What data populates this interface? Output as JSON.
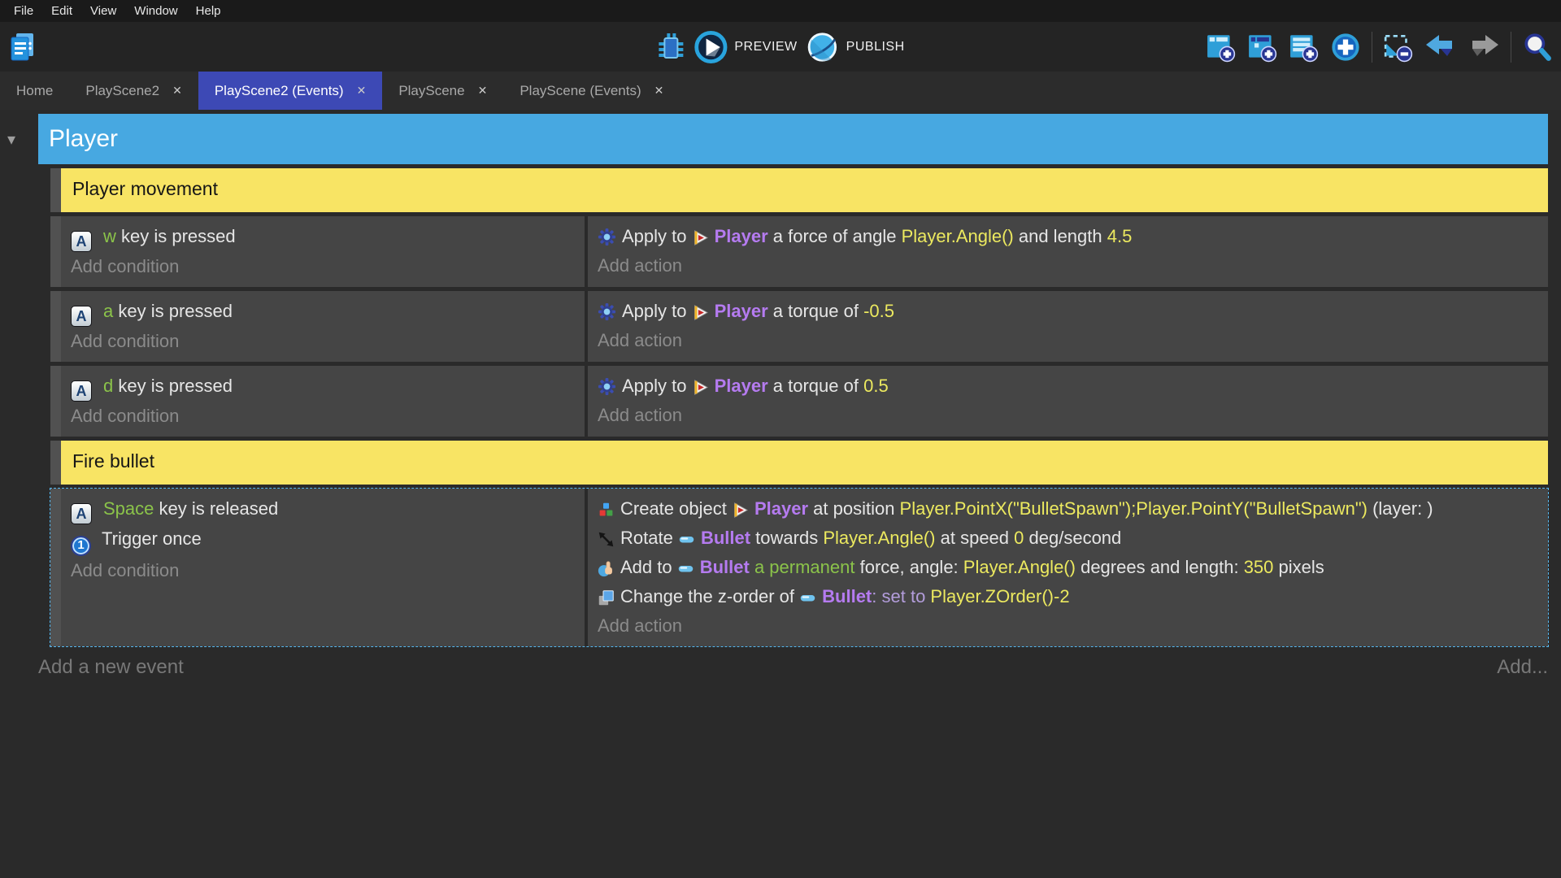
{
  "menu": {
    "items": [
      "File",
      "Edit",
      "View",
      "Window",
      "Help"
    ]
  },
  "toolbar": {
    "preview_label": "PREVIEW",
    "publish_label": "PUBLISH",
    "accent_color": "#2f9fd8"
  },
  "tabs": [
    {
      "label": "Home",
      "closable": false,
      "active": false
    },
    {
      "label": "PlayScene2",
      "closable": true,
      "active": false
    },
    {
      "label": "PlayScene2 (Events)",
      "closable": true,
      "active": true
    },
    {
      "label": "PlayScene",
      "closable": true,
      "active": false
    },
    {
      "label": "PlayScene (Events)",
      "closable": true,
      "active": false
    }
  ],
  "icons": {
    "close_glyph": "✕",
    "collapse_glyph": "▾"
  },
  "sheet": {
    "group_title": "Player",
    "add_condition": "Add condition",
    "add_action": "Add action",
    "add_new_event": "Add a new event",
    "add_more": "Add...",
    "colors": {
      "group_bar": "#47a8e1",
      "comment_bg": "#f8e464",
      "selection": "#56b7ef",
      "key": "#8bc34a",
      "object": "#b57bf0",
      "expression": "#ece95f"
    },
    "rows": [
      {
        "type": "comment",
        "text": "Player movement"
      },
      {
        "type": "event",
        "selected": false,
        "conditions": [
          [
            {
              "icon": "keyboard-key-icon"
            },
            {
              "s": "key",
              "t": "w"
            },
            {
              "s": "text",
              "t": " key is pressed"
            }
          ]
        ],
        "actions": [
          [
            {
              "icon": "physics-force-icon"
            },
            {
              "s": "text",
              "t": "Apply to "
            },
            {
              "icon": "player-object-icon"
            },
            {
              "s": "obj",
              "t": "Player"
            },
            {
              "s": "text",
              "t": " a force of angle "
            },
            {
              "s": "expr",
              "t": "Player.Angle()"
            },
            {
              "s": "text",
              "t": " and length "
            },
            {
              "s": "expr",
              "t": "4.5"
            }
          ]
        ]
      },
      {
        "type": "event",
        "selected": false,
        "conditions": [
          [
            {
              "icon": "keyboard-key-icon"
            },
            {
              "s": "key",
              "t": "a"
            },
            {
              "s": "text",
              "t": " key is pressed"
            }
          ]
        ],
        "actions": [
          [
            {
              "icon": "physics-force-icon"
            },
            {
              "s": "text",
              "t": "Apply to "
            },
            {
              "icon": "player-object-icon"
            },
            {
              "s": "obj",
              "t": "Player"
            },
            {
              "s": "text",
              "t": " a torque of "
            },
            {
              "s": "expr",
              "t": "-0.5"
            }
          ]
        ]
      },
      {
        "type": "event",
        "selected": false,
        "conditions": [
          [
            {
              "icon": "keyboard-key-icon"
            },
            {
              "s": "key",
              "t": "d"
            },
            {
              "s": "text",
              "t": " key is pressed"
            }
          ]
        ],
        "actions": [
          [
            {
              "icon": "physics-force-icon"
            },
            {
              "s": "text",
              "t": "Apply to "
            },
            {
              "icon": "player-object-icon"
            },
            {
              "s": "obj",
              "t": "Player"
            },
            {
              "s": "text",
              "t": " a torque of "
            },
            {
              "s": "expr",
              "t": "0.5"
            }
          ]
        ]
      },
      {
        "type": "comment",
        "text": "Fire bullet"
      },
      {
        "type": "event",
        "selected": true,
        "conditions": [
          [
            {
              "icon": "keyboard-key-icon"
            },
            {
              "s": "key",
              "t": "Space"
            },
            {
              "s": "text",
              "t": " key is released"
            }
          ],
          [
            {
              "icon": "trigger-once-icon"
            },
            {
              "s": "text",
              "t": "Trigger once"
            }
          ]
        ],
        "actions": [
          [
            {
              "icon": "create-object-icon"
            },
            {
              "s": "text",
              "t": "Create object "
            },
            {
              "icon": "player-object-icon"
            },
            {
              "s": "obj",
              "t": "Player"
            },
            {
              "s": "text",
              "t": " at position "
            },
            {
              "s": "expr",
              "t": "Player.PointX(\"BulletSpawn\");Player.PointY(\"BulletSpawn\")"
            },
            {
              "s": "text",
              "t": " (layer: )"
            }
          ],
          [
            {
              "icon": "rotate-icon"
            },
            {
              "s": "text",
              "t": "Rotate "
            },
            {
              "icon": "bullet-object-icon"
            },
            {
              "s": "obj",
              "t": "Bullet"
            },
            {
              "s": "text",
              "t": " towards "
            },
            {
              "s": "expr",
              "t": "Player.Angle()"
            },
            {
              "s": "text",
              "t": " at speed "
            },
            {
              "s": "expr",
              "t": "0"
            },
            {
              "s": "text",
              "t": " deg/second"
            }
          ],
          [
            {
              "icon": "add-force-icon"
            },
            {
              "s": "text",
              "t": "Add to "
            },
            {
              "icon": "bullet-object-icon"
            },
            {
              "s": "obj",
              "t": "Bullet"
            },
            {
              "s": "green",
              "t": " a permanent "
            },
            {
              "s": "text",
              "t": "force, angle: "
            },
            {
              "s": "expr",
              "t": "Player.Angle()"
            },
            {
              "s": "text",
              "t": " degrees and length: "
            },
            {
              "s": "expr",
              "t": "350"
            },
            {
              "s": "text",
              "t": " pixels"
            }
          ],
          [
            {
              "icon": "zorder-icon"
            },
            {
              "s": "text",
              "t": "Change the z-order of "
            },
            {
              "icon": "bullet-object-icon"
            },
            {
              "s": "obj",
              "t": "Bullet"
            },
            {
              "s": "setto",
              "t": ": set to "
            },
            {
              "s": "expr",
              "t": "Player.ZOrder()-2"
            }
          ]
        ]
      }
    ]
  }
}
